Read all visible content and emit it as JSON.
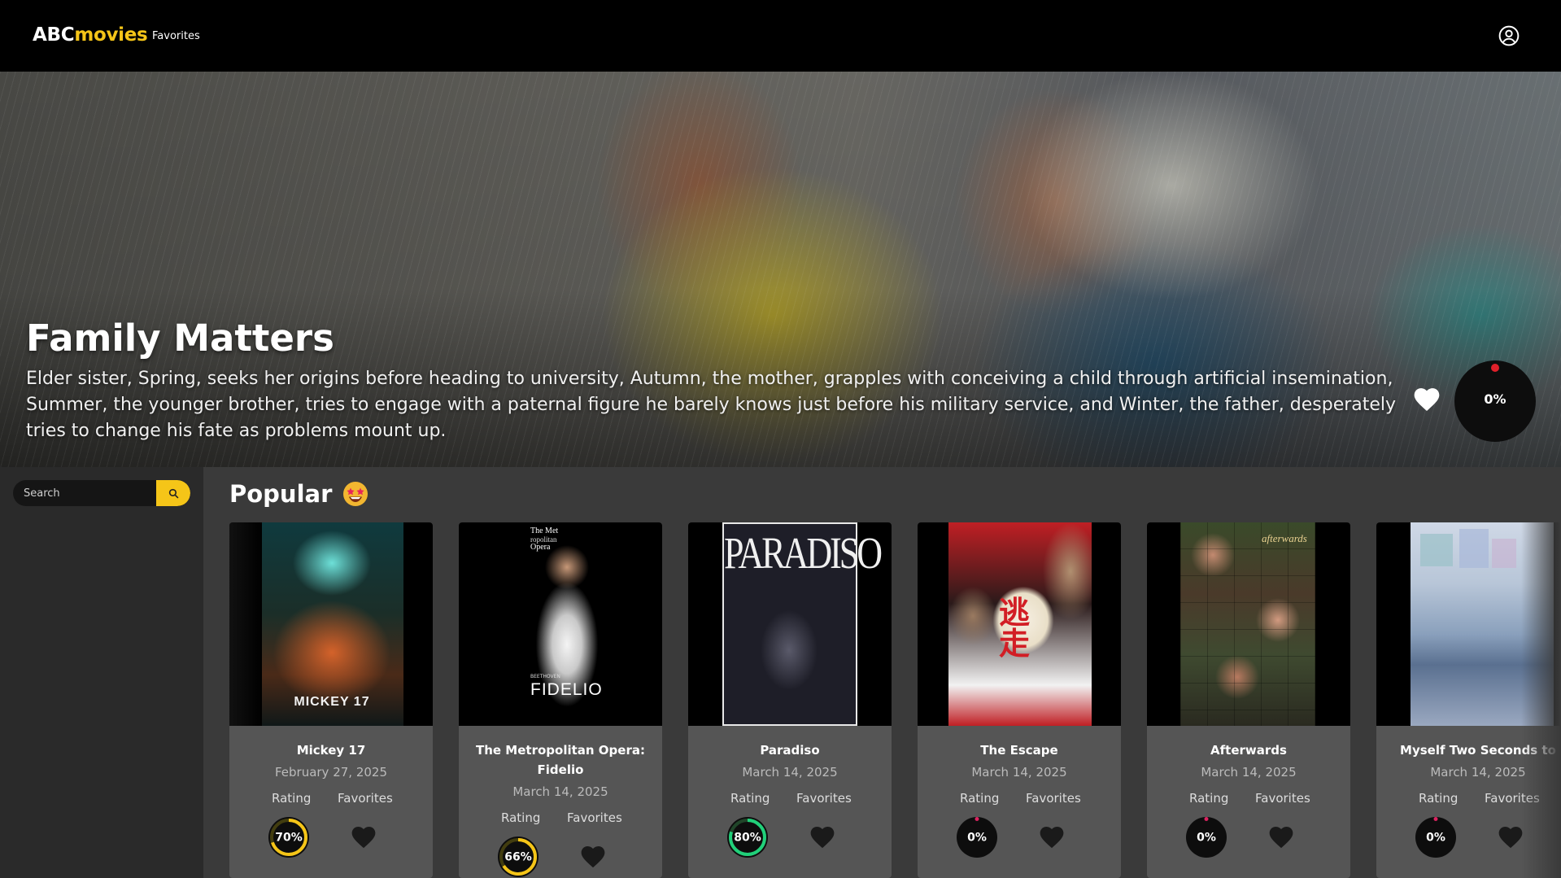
{
  "navbar": {
    "logo_abc": "ABC",
    "logo_movies": "movies",
    "favorites_link": "Favorites",
    "user_icon": "user-circle-icon"
  },
  "hero": {
    "title": "Family Matters",
    "description": "Elder sister, Spring, seeks her origins before heading to university, Autumn, the mother, grapples with conceiving a child through artificial insemination, Summer, the younger brother, tries to engage with a paternal figure he barely knows just before his military service, and Winter, the father, desperately tries to change his fate as problems mount up.",
    "rating_label": "0%",
    "rating_value": 0
  },
  "sidebar": {
    "search_placeholder": "Search",
    "search_icon": "search-icon"
  },
  "main": {
    "section_title": "Popular",
    "section_emoji": "star-struck-emoji",
    "rating_label": "Rating",
    "favorites_label": "Favorites",
    "movies": [
      {
        "title": "Mickey 17",
        "date": "February 27, 2025",
        "rating": "70%",
        "rating_value": 70,
        "poster_text": "MICKEY 17"
      },
      {
        "title": "The Metropolitan Opera: Fidelio",
        "date": "March 14, 2025",
        "rating": "66%",
        "rating_value": 66,
        "poster_text": "FIDELIO",
        "poster_small": "BEETHOVEN",
        "poster_top1": "The Met",
        "poster_top2": "ropolitan",
        "poster_top3": "Opera"
      },
      {
        "title": "Paradiso",
        "date": "March 14, 2025",
        "rating": "80%",
        "rating_value": 80,
        "poster_text": "PARADISO"
      },
      {
        "title": "The Escape",
        "date": "March 14, 2025",
        "rating": "0%",
        "rating_value": 0,
        "poster_text": "逃走"
      },
      {
        "title": "Afterwards",
        "date": "March 14, 2025",
        "rating": "0%",
        "rating_value": 0,
        "poster_text": "afterwards"
      },
      {
        "title": "Myself Two Seconds to",
        "date": "March 14, 2025",
        "rating": "0%",
        "rating_value": 0
      }
    ]
  },
  "colors": {
    "accent": "#f5c518",
    "rating_high": "#21d07a",
    "rating_mid": "#d2d531",
    "rating_zero": "#db2360",
    "card_bg": "#555555",
    "page_bg": "#3a3a3a"
  }
}
